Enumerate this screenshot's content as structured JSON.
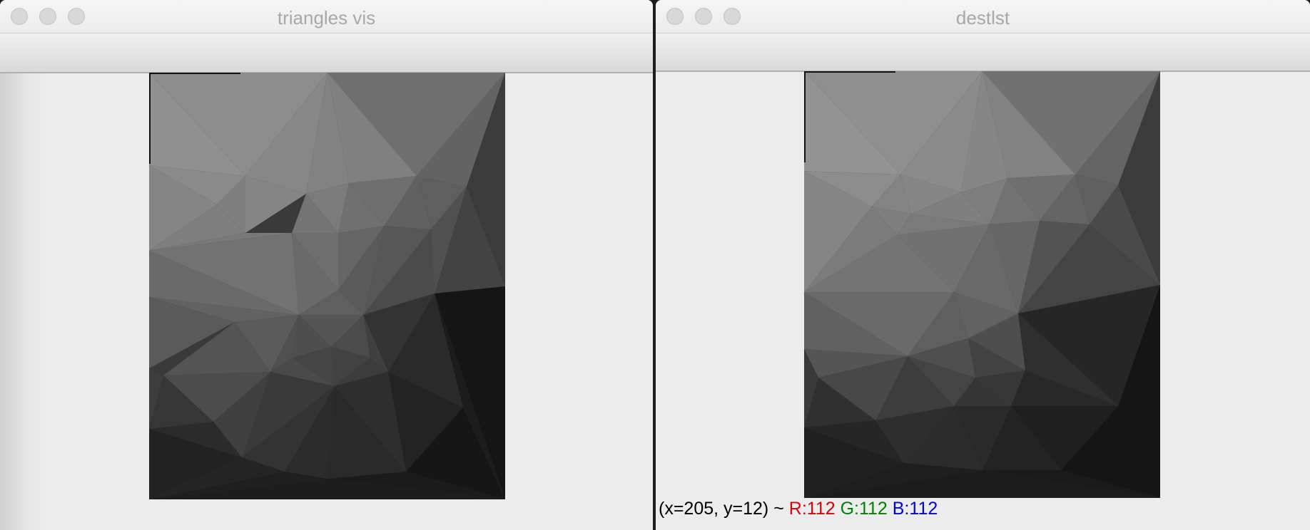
{
  "windows": {
    "left": {
      "title": "triangles vis"
    },
    "right": {
      "title": "destlst"
    }
  },
  "status_bar": {
    "coords": "(x=205, y=12) ~",
    "r": "R:112",
    "g": "G:112",
    "b": "B:112"
  },
  "colors": {
    "status_r": "#e00000",
    "status_g": "#008000",
    "status_b": "#0000e0",
    "title_text": "#a8a8a8",
    "window_bg": "#ececec"
  }
}
